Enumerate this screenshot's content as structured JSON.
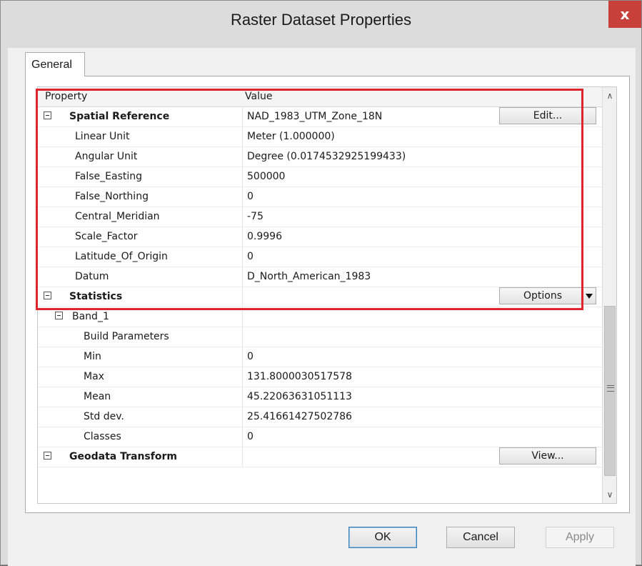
{
  "window": {
    "title": "Raster Dataset Properties",
    "close_glyph": "x"
  },
  "tabs": [
    {
      "label": "General",
      "selected": true
    }
  ],
  "grid": {
    "columns": {
      "property": "Property",
      "value": "Value"
    },
    "rows": [
      {
        "property": "Spatial Reference",
        "value": "NAD_1983_UTM_Zone_18N",
        "bold": true,
        "collapsible": true,
        "button": "Edit..."
      },
      {
        "property": "Linear Unit",
        "value": "Meter (1.000000)"
      },
      {
        "property": "Angular Unit",
        "value": "Degree (0.0174532925199433)"
      },
      {
        "property": "False_Easting",
        "value": "500000"
      },
      {
        "property": "False_Northing",
        "value": "0"
      },
      {
        "property": "Central_Meridian",
        "value": "-75"
      },
      {
        "property": "Scale_Factor",
        "value": "0.9996"
      },
      {
        "property": "Latitude_Of_Origin",
        "value": "0"
      },
      {
        "property": "Datum",
        "value": "D_North_American_1983"
      },
      {
        "property": "Statistics",
        "value": "",
        "bold": true,
        "collapsible": true,
        "button": "Options"
      },
      {
        "property": "Band_1",
        "value": "",
        "collapsible": true
      },
      {
        "property": "Build Parameters",
        "value": ""
      },
      {
        "property": "Min",
        "value": "0"
      },
      {
        "property": "Max",
        "value": "131.8000030517578"
      },
      {
        "property": "Mean",
        "value": "45.22063631051113"
      },
      {
        "property": "Std dev.",
        "value": "25.41661427502786"
      },
      {
        "property": "Classes",
        "value": "0"
      },
      {
        "property": "Geodata Transform",
        "value": "",
        "bold": true,
        "collapsible": true,
        "button": "View..."
      }
    ]
  },
  "buttons": {
    "ok": "OK",
    "cancel": "Cancel",
    "apply": "Apply"
  },
  "scrollbar": {
    "up_glyph": "∧",
    "down_glyph": "∨"
  },
  "colors": {
    "highlight": "#e0242d",
    "close": "#c7403a"
  }
}
